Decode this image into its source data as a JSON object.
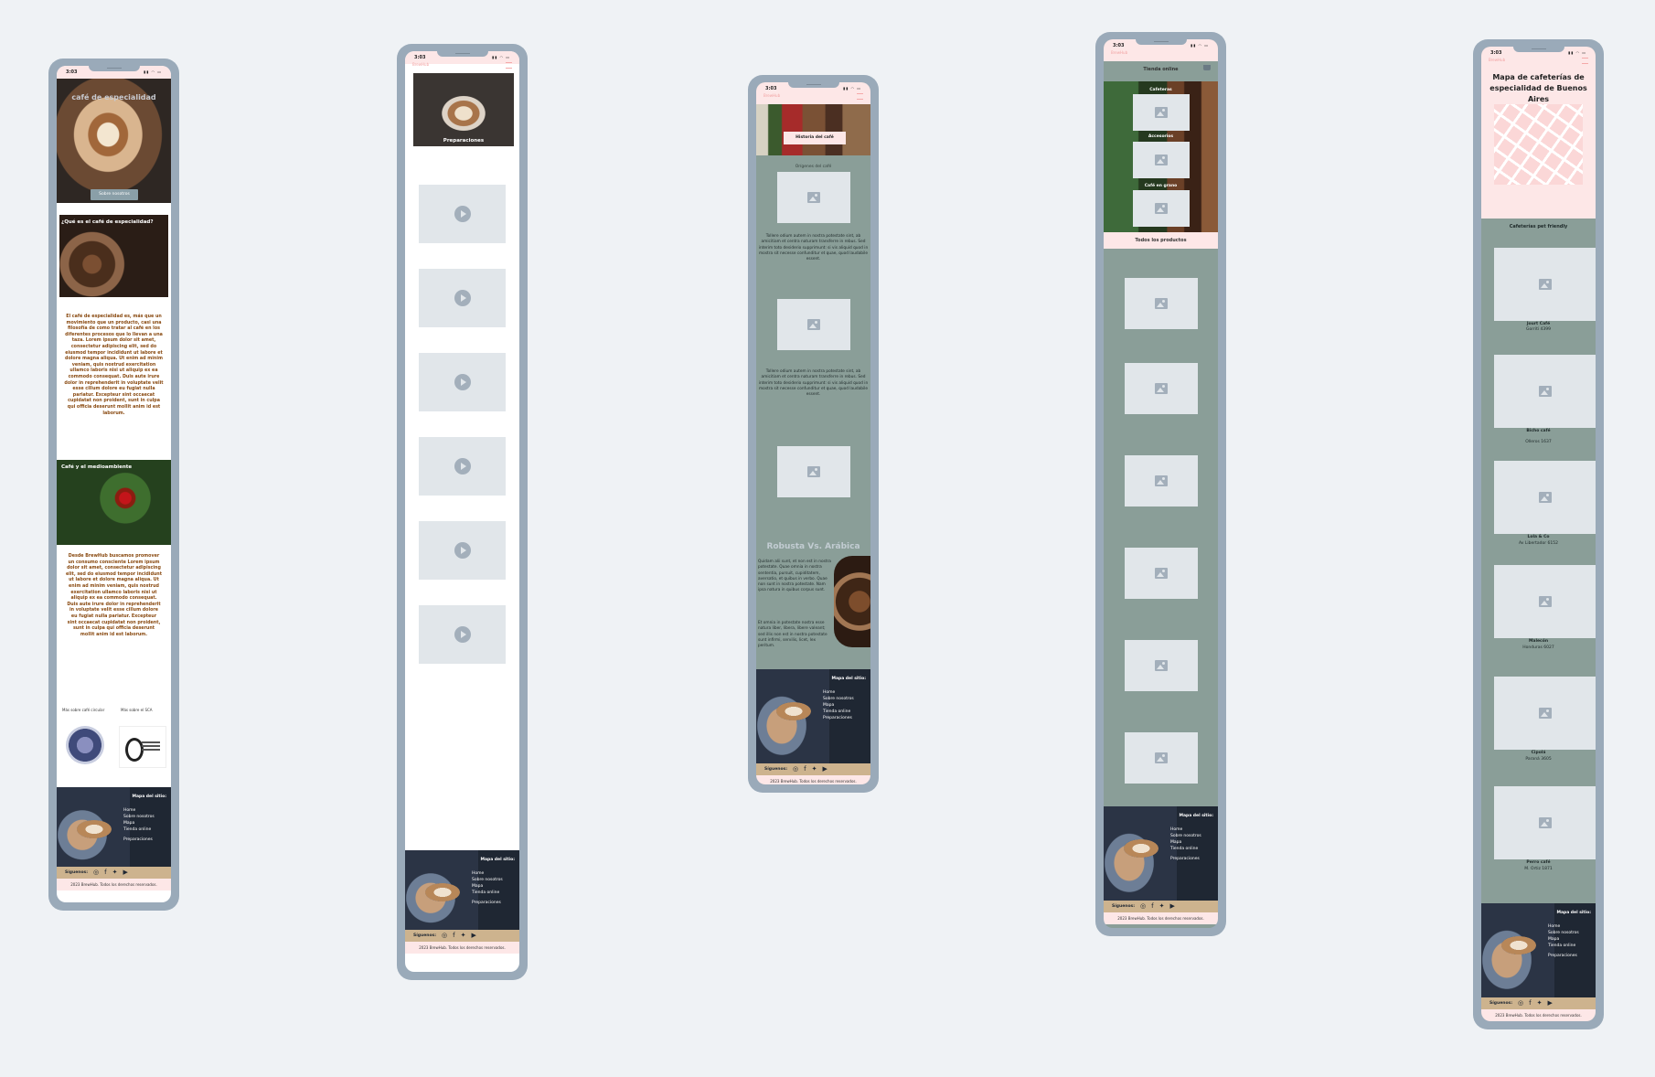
{
  "status": {
    "time": "3:03",
    "indicators": "▮▮ ◠ ▭"
  },
  "brand": "BrewHub",
  "footer": {
    "map_title": "Mapa del sitio:",
    "links": [
      "Home",
      "Sobre nosotros",
      "Mapa",
      "Tienda online",
      "Preparaciones"
    ],
    "follow_label": "Síguenos:",
    "social_icons": [
      "instagram-icon",
      "facebook-icon",
      "twitter-icon",
      "youtube-icon"
    ],
    "copyright": "2023 BrewHub. Todos los derechos reservados."
  },
  "screen1": {
    "hero_title": "café de especialidad",
    "hero_button": "Sobre nosotros",
    "section1_title": "¿Qué es el café de especialidad?",
    "paragraph1": "El café de especialidad es, más que un movimiento que un producto, casi una filosofía de como tratar al café en los diferentes procesos que lo llevan a una taza. Lorem ipsum dolor sit amet, consectetur adipiscing elit, sed do eiusmod tempor incididunt ut labore et dolore magna aliqua. Ut enim ad minim veniam, quis nostrud exercitation ullamco laboris nisi ut aliquip ex ea commodo consequat. Duis aute irure dolor in reprehenderit in voluptate velit esse cillum dolore eu fugiat nulla pariatur. Excepteur sint occaecat cupidatat non proident, sunt in culpa qui officia deserunt mollit anim id est laborum.",
    "section2_title": "Café y el medioambiente",
    "paragraph2": "Desde BrewHub buscamos promover un consumo consciente Lorem ipsum dolor sit amet, consectetur adipiscing elit, sed do eiusmod tempor incididunt ut labore et dolore magna aliqua. Ut enim ad minim veniam, quis nostrud exercitation ullamco laboris nisi ut aliquip ex ea commodo consequat. Duis aute irure dolor in reprehenderit in voluptate velit esse cillum dolore eu fugiat nulla pariatur. Excepteur sint occaecat cupidatat non proident, sunt in culpa qui officia deserunt mollit anim id est laborum.",
    "link1": "Más sobre café circular",
    "link2": "Más sobre el SCA"
  },
  "screen2": {
    "hero_label": "Preparaciones",
    "videos": 6
  },
  "screen3": {
    "hero_button": "Historia del café",
    "origins": "Orígenes del café",
    "lorem": "Tollere odium autem in nostra potestate sint, ab amicitiam et centra naturam transferre in rebus. Sed interim toto desiderio supprimunt: si vis aliquid quod in mostra sit necesse confunditur et quae, quod laudabile essent.",
    "section_title": "Robusta Vs. Arábica",
    "paragraph_a": "Quidam alii sunt, et non est in nostra potestate. Quae omnia in nostra sententia, pursuit, cupiditatem, aversatio, et quibus in verbo. Quae non sunt in nostra potestate. Nam ipsa natura in quibus corpus sunt.",
    "paragraph_b": "Et omnia in potestate nostra esse natura liber, libera, libere valeant; sed illis non est in nostra potestate sunt infirmi, servilis, licet, lex peritum."
  },
  "screen4": {
    "header": "Tienda online",
    "categories": [
      "Cafeteras",
      "Accesorios",
      "Café en grano"
    ],
    "all_products": "Todos los productos",
    "products": 6
  },
  "screen5": {
    "title": "Mapa de cafeterías de especialidad de Buenos Aires",
    "subtitle": "Cafeterías pet friendly",
    "cafes": [
      {
        "name": "Jourt Café",
        "address": "Gorriti 4399"
      },
      {
        "name": "Bicho café",
        "address": "Olleros 1637"
      },
      {
        "name": "Lola & Co",
        "address": "Av Libertador 6152"
      },
      {
        "name": "Malecón",
        "address": "Honduras 6027"
      },
      {
        "name": "Cipolá",
        "address": "Paraná 3605"
      },
      {
        "name": "Perro café",
        "address": "M. Ortiz 1871"
      }
    ]
  },
  "colors": {
    "accent_pink": "#fde7e7",
    "sage": "#8a9e98",
    "footer_tan": "#cdb38e",
    "text_brown": "#8a4b12"
  }
}
